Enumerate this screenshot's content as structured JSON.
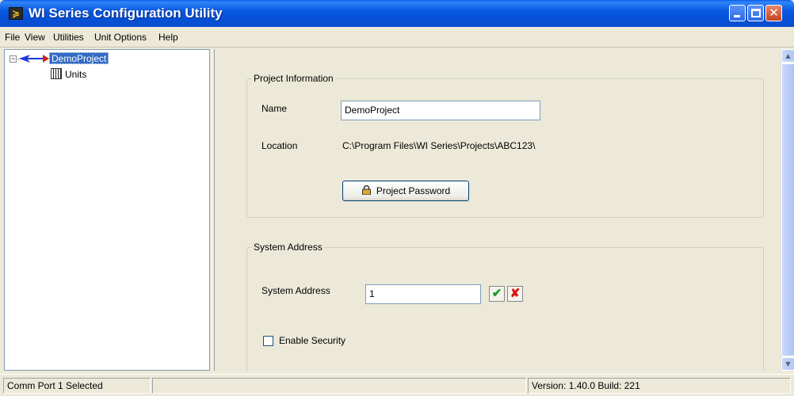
{
  "window": {
    "title": "WI Series Configuration Utility",
    "app_icon": "wi-logo-icon"
  },
  "menu": {
    "items": [
      {
        "label": "File"
      },
      {
        "label": "View"
      },
      {
        "label": "Utilities"
      },
      {
        "label": "Unit Options"
      },
      {
        "label": "Help"
      }
    ]
  },
  "tree": {
    "root": {
      "label": "DemoProject",
      "icon": "arrow-icon",
      "expanded": true,
      "selected": true
    },
    "children": [
      {
        "label": "Units",
        "icon": "units-icon"
      }
    ]
  },
  "project_info": {
    "legend": "Project Information",
    "name_label": "Name",
    "name_value": "DemoProject",
    "location_label": "Location",
    "location_value": "C:\\Program Files\\WI Series\\Projects\\ABC123\\",
    "password_button": "Project Password"
  },
  "system_address": {
    "legend": "System Address",
    "field_label": "System Address",
    "field_value": "1",
    "apply_icon": "check-icon",
    "cancel_icon": "x-icon",
    "enable_security_label": "Enable Security",
    "enable_security_checked": false
  },
  "status": {
    "left": "Comm Port 1 Selected",
    "middle": "",
    "right": "Version: 1.40.0 Build: 221"
  },
  "colors": {
    "titlebar": "#0A58E0",
    "selection": "#316AC5",
    "background": "#ECE9D8"
  }
}
